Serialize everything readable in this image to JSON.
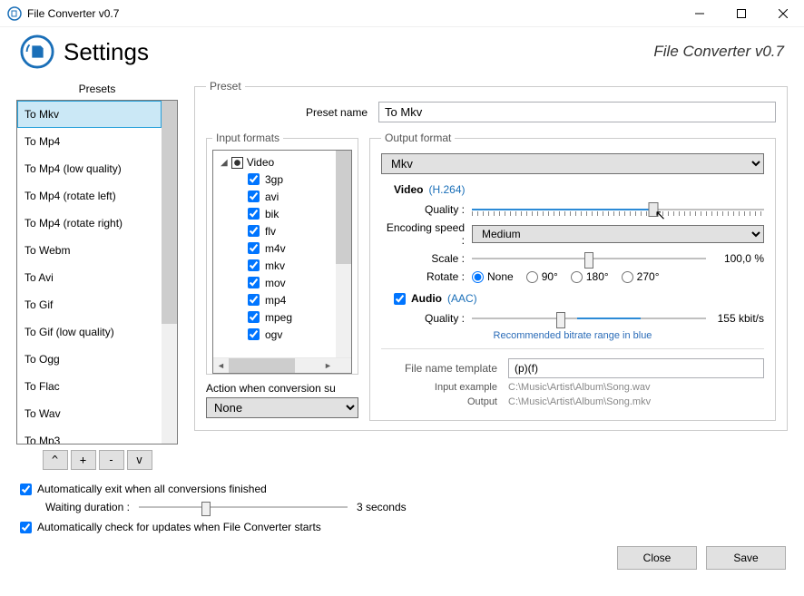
{
  "titlebar": {
    "title": "File Converter v0.7"
  },
  "header": {
    "heading": "Settings",
    "subtitle": "File Converter v0.7"
  },
  "presets": {
    "group_label": "Presets",
    "items": [
      "To Mkv",
      "To Mp4",
      "To Mp4 (low quality)",
      "To Mp4 (rotate left)",
      "To Mp4 (rotate right)",
      "To Webm",
      "To Avi",
      "To Gif",
      "To Gif (low quality)",
      "To Ogg",
      "To Flac",
      "To Wav",
      "To Mp3"
    ],
    "selected_index": 0,
    "btn_up": "^",
    "btn_add": "+",
    "btn_remove": "-",
    "btn_down": "v"
  },
  "preset_panel": {
    "legend": "Preset",
    "name_label": "Preset name",
    "name_value": "To Mkv",
    "input_formats": {
      "legend": "Input formats",
      "root": "Video",
      "items": [
        "3gp",
        "avi",
        "bik",
        "flv",
        "m4v",
        "mkv",
        "mov",
        "mp4",
        "mpeg",
        "ogv"
      ]
    },
    "action_label": "Action when conversion su",
    "action_value": "None",
    "output": {
      "legend": "Output format",
      "format_value": "Mkv",
      "video_label": "Video",
      "video_codec": "(H.264)",
      "quality_label": "Quality :",
      "encoding_label": "Encoding speed :",
      "encoding_value": "Medium",
      "scale_label": "Scale :",
      "scale_value": "100,0 %",
      "rotate_label": "Rotate :",
      "rotate_options": [
        "None",
        "90°",
        "180°",
        "270°"
      ],
      "rotate_selected": 0,
      "audio_label": "Audio",
      "audio_codec": "(AAC)",
      "audio_quality_label": "Quality :",
      "audio_quality_value": "155 kbit/s",
      "reco": "Recommended bitrate range in blue",
      "fnt_label": "File name template",
      "fnt_value": "(p)(f)",
      "input_ex_label": "Input example",
      "input_ex_value": "C:\\Music\\Artist\\Album\\Song.wav",
      "output_ex_label": "Output",
      "output_ex_value": "C:\\Music\\Artist\\Album\\Song.mkv"
    }
  },
  "bottom": {
    "auto_exit": "Automatically exit when all conversions finished",
    "wait_label": "Waiting duration :",
    "wait_value": "3 seconds",
    "auto_update": "Automatically check for updates when File Converter starts"
  },
  "footer": {
    "close": "Close",
    "save": "Save"
  }
}
